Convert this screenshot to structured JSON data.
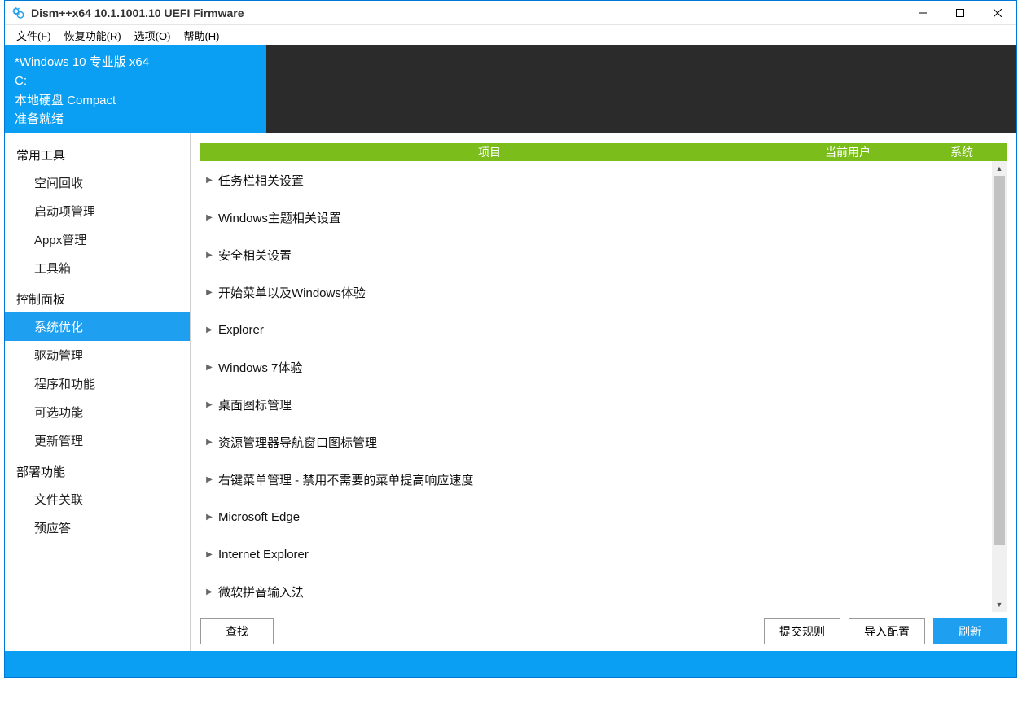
{
  "window": {
    "title": "Dism++x64 10.1.1001.10 UEFI Firmware"
  },
  "menu": {
    "file": "文件(F)",
    "recover": "恢复功能(R)",
    "options": "选项(O)",
    "help": "帮助(H)"
  },
  "info": {
    "os_line": "*Windows 10 专业版 x64",
    "drive": "C:",
    "disk": "本地硬盘 Compact",
    "status": "准备就绪"
  },
  "sidebar": {
    "groups": [
      {
        "title": "常用工具",
        "items": [
          "空间回收",
          "启动项管理",
          "Appx管理",
          "工具箱"
        ]
      },
      {
        "title": "控制面板",
        "items": [
          "系统优化",
          "驱动管理",
          "程序和功能",
          "可选功能",
          "更新管理"
        ]
      },
      {
        "title": "部署功能",
        "items": [
          "文件关联",
          "预应答"
        ]
      }
    ],
    "selected": "系统优化"
  },
  "columns": {
    "project": "项目",
    "user": "当前用户",
    "system": "系统"
  },
  "tree": [
    "任务栏相关设置",
    "Windows主题相关设置",
    "安全相关设置",
    "开始菜单以及Windows体验",
    "Explorer",
    "Windows 7体验",
    "桌面图标管理",
    "资源管理器导航窗口图标管理",
    "右键菜单管理 - 禁用不需要的菜单提高响应速度",
    "Microsoft Edge",
    "Internet Explorer",
    "微软拼音输入法"
  ],
  "buttons": {
    "find": "查找",
    "submit": "提交规则",
    "import": "导入配置",
    "refresh": "刷新"
  }
}
